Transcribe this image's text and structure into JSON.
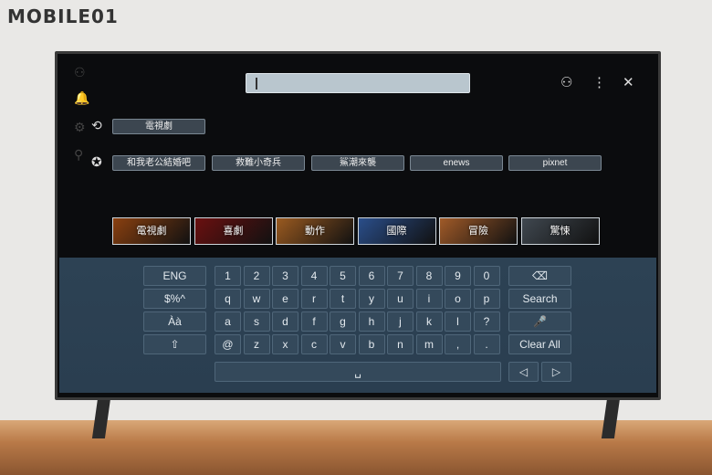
{
  "watermark": "MOBILE01",
  "search": {
    "value": "",
    "placeholder": ""
  },
  "top_icons": [
    "user-icon",
    "more-vert-icon",
    "close-icon"
  ],
  "sidebar_icons": [
    "user-icon",
    "bell-icon",
    "gear-icon",
    "search-icon"
  ],
  "recent": {
    "icon": "history-icon",
    "items": [
      "電視劇"
    ]
  },
  "popular": {
    "icon": "award-icon",
    "items": [
      "和我老公結婚吧",
      "救難小奇兵",
      "鯊潮來襲",
      "enews",
      "pixnet"
    ]
  },
  "categories": [
    {
      "label": "電視劇",
      "color": "#8a4010"
    },
    {
      "label": "喜劇",
      "color": "#6a1010"
    },
    {
      "label": "動作",
      "color": "#9a5a20"
    },
    {
      "label": "國際",
      "color": "#2a4e8a"
    },
    {
      "label": "冒險",
      "color": "#a05a28"
    },
    {
      "label": "驚悚",
      "color": "#404850"
    }
  ],
  "keyboard": {
    "left": [
      "ENG",
      "$%^",
      "Àà",
      "⇧"
    ],
    "rows": [
      [
        "1",
        "2",
        "3",
        "4",
        "5",
        "6",
        "7",
        "8",
        "9",
        "0"
      ],
      [
        "q",
        "w",
        "e",
        "r",
        "t",
        "y",
        "u",
        "i",
        "o",
        "p"
      ],
      [
        "a",
        "s",
        "d",
        "f",
        "g",
        "h",
        "j",
        "k",
        "l",
        "?"
      ],
      [
        "@",
        "z",
        "x",
        "c",
        "v",
        "b",
        "n",
        "m",
        ",",
        "."
      ]
    ],
    "right": [
      "⌫",
      "Search",
      "🎤",
      "Clear All"
    ],
    "space": "␣",
    "arrows": [
      "◁",
      "▷"
    ]
  }
}
